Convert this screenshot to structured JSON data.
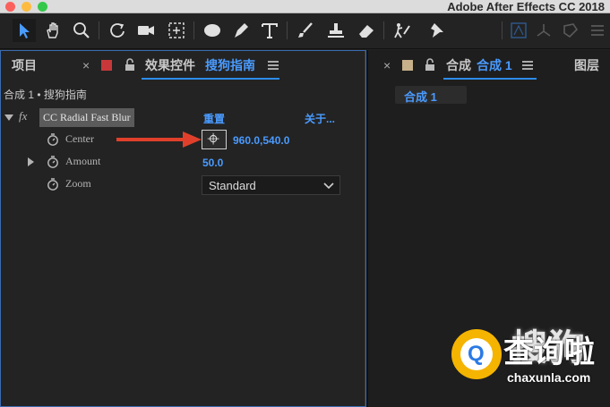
{
  "window": {
    "title": "Adobe After Effects CC 2018"
  },
  "toolbar": {
    "tools": [
      {
        "icon": "selection-tool-icon",
        "active": true
      },
      {
        "icon": "hand-tool-icon"
      },
      {
        "icon": "zoom-tool-icon"
      },
      {
        "icon": "rotation-tool-icon"
      },
      {
        "icon": "camera-tool-icon"
      },
      {
        "icon": "pan-behind-tool-icon"
      },
      {
        "icon": "ellipse-tool-icon"
      },
      {
        "icon": "pen-tool-icon"
      },
      {
        "icon": "type-tool-icon"
      },
      {
        "icon": "brush-tool-icon"
      },
      {
        "icon": "clone-stamp-tool-icon"
      },
      {
        "icon": "eraser-tool-icon"
      },
      {
        "icon": "roto-brush-tool-icon"
      },
      {
        "icon": "puppet-pin-tool-icon"
      }
    ]
  },
  "left_panel": {
    "project_tab": "项目",
    "effects_tab_prefix": "效果控件",
    "effects_tab_layer": "搜狗指南",
    "breadcrumb": "合成 1 • 搜狗指南",
    "effect": {
      "fx": "fx",
      "name": "CC Radial Fast Blur",
      "reset": "重置",
      "about": "关于..."
    },
    "properties": [
      {
        "label": "Center",
        "value": "960.0,540.0"
      },
      {
        "label": "Amount",
        "value": "50.0"
      },
      {
        "label": "Zoom",
        "value": "Standard"
      }
    ]
  },
  "right_panel": {
    "comp_tab_prefix": "合成",
    "comp_tab_name": "合成 1",
    "layer_tab": "图层",
    "comp_chip": "合成 1",
    "viewer_text": "搜狗"
  },
  "watermark": {
    "badge": "Q",
    "text": "查询啦",
    "url": "chaxunla.com"
  },
  "colors": {
    "accent": "#4a9bff",
    "effects_swatch": "#c8383a",
    "comp_swatch": "#c7b08a",
    "annotation_arrow": "#e0402b"
  }
}
